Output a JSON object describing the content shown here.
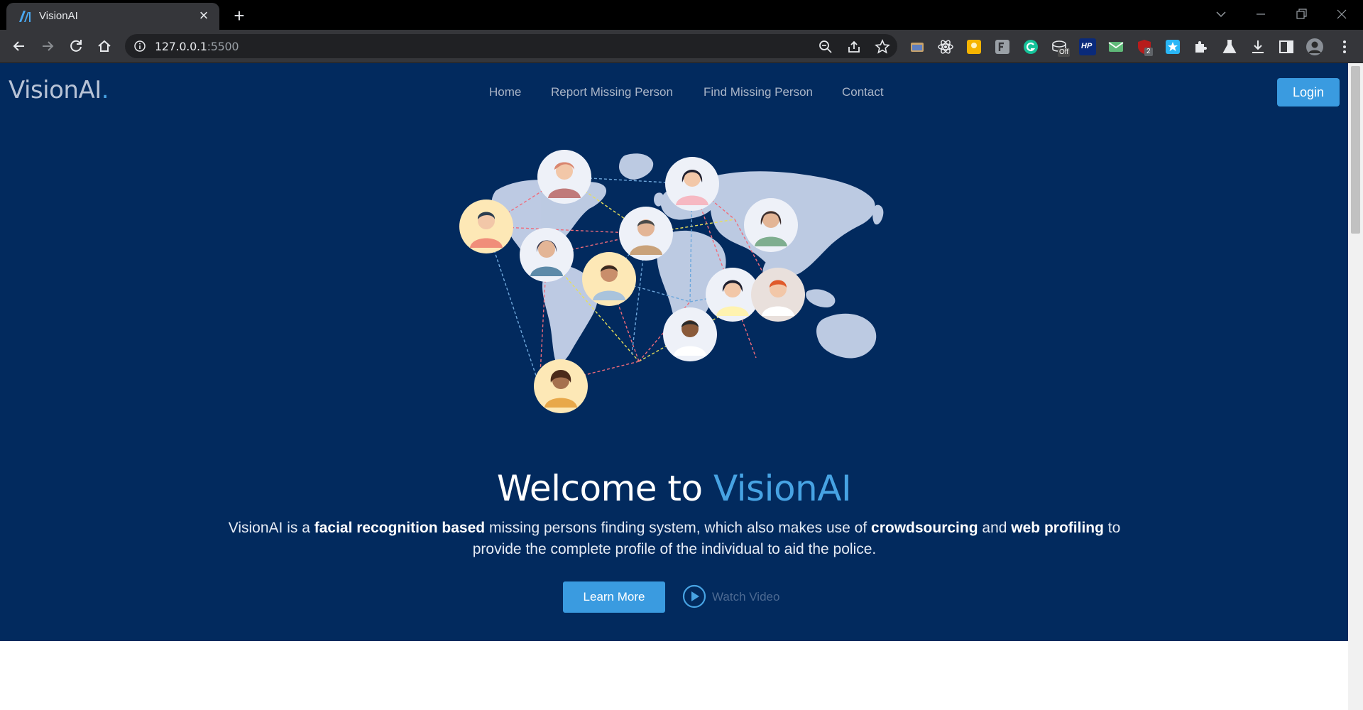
{
  "browser": {
    "tab_title": "VisionAI",
    "new_tab_symbol": "+",
    "close_symbol": "×",
    "url_host": "127.0.0.1",
    "url_port": ":5500",
    "extension_off_badge": "Off",
    "extension_count_badge": "2",
    "extension_hp_label": "HP"
  },
  "site": {
    "logo_text": "VisionAI",
    "logo_dot": ".",
    "nav": [
      "Home",
      "Report Missing Person",
      "Find Missing Person",
      "Contact"
    ],
    "login_label": "Login"
  },
  "hero": {
    "title_prefix": "Welcome to ",
    "title_accent": "VisionAI",
    "desc_1": "VisionAI is a ",
    "desc_bold_1": "facial recognition based",
    "desc_2": " missing persons finding system, which also makes use of ",
    "desc_bold_2": "crowdsourcing",
    "desc_3": " and ",
    "desc_bold_3": "web profiling",
    "desc_4": " to provide the complete profile of the individual to aid the police.",
    "learn_more_label": "Learn More",
    "watch_video_label": "Watch Video"
  },
  "colors": {
    "hero_background": "#022a5e",
    "accent": "#47a3e3",
    "button": "#3a9be0"
  }
}
